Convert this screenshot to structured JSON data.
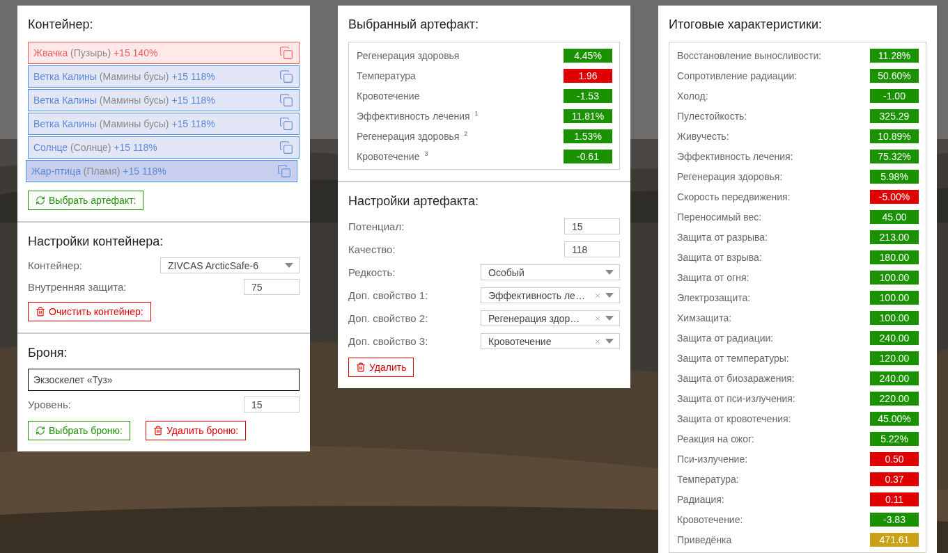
{
  "container": {
    "title": "Контейнер:",
    "artifacts": [
      {
        "name": "Жвачка",
        "type": "(Пузырь)",
        "bonus": "+15 140%",
        "kind": "negative",
        "selected": false
      },
      {
        "name": "Ветка Калины",
        "type": "(Мамины бусы)",
        "bonus": "+15 118%",
        "kind": "positive",
        "selected": false
      },
      {
        "name": "Ветка Калины",
        "type": "(Мамины бусы)",
        "bonus": "+15 118%",
        "kind": "positive",
        "selected": false
      },
      {
        "name": "Ветка Калины",
        "type": "(Мамины бусы)",
        "bonus": "+15 118%",
        "kind": "positive",
        "selected": false
      },
      {
        "name": "Солнце",
        "type": "(Солнце)",
        "bonus": "+15 118%",
        "kind": "positive",
        "selected": false
      },
      {
        "name": "Жар-птица",
        "type": "(Пламя)",
        "bonus": "+15 118%",
        "kind": "positive",
        "selected": true
      }
    ],
    "select_button": "Выбрать артефакт:"
  },
  "container_settings": {
    "title": "Настройки контейнера:",
    "fields": [
      {
        "label": "Контейнер:",
        "kind": "select",
        "value": "ZIVCAS ArcticSafe-6",
        "clearable": false
      },
      {
        "label": "Внутренняя защита:",
        "kind": "number",
        "value": "75"
      }
    ],
    "clear_button": "Очистить контейнер:"
  },
  "armor": {
    "title": "Броня:",
    "name": "Экзоскелет «Туз»",
    "fields": [
      {
        "label": "Уровень:",
        "kind": "number",
        "value": "15"
      }
    ],
    "select_button": "Выбрать броню:",
    "delete_button": "Удалить броню:"
  },
  "selected_artifact": {
    "title": "Выбранный артефакт:",
    "stats": [
      {
        "label": "Регенерация здоровья",
        "value": "4.45%",
        "color": "#1a9200"
      },
      {
        "label": "Температура",
        "value": "1.96",
        "color": "#e00000"
      },
      {
        "label": "Кровотечение",
        "value": "-1.53",
        "color": "#1a9200"
      },
      {
        "label": "Эффективность лечения $^{1}$",
        "value": "11.81%",
        "color": "#1a9200"
      },
      {
        "label": "Регенерация здоровья $^{2}$",
        "value": "1.53%",
        "color": "#1a9200"
      },
      {
        "label": "Кровотечение $^{3}$",
        "value": "-0.61",
        "color": "#1a9200"
      }
    ]
  },
  "artifact_settings": {
    "title": "Настройки артефакта:",
    "fields": [
      {
        "label": "Потенциал:",
        "kind": "number",
        "value": "15"
      },
      {
        "label": "Качество:",
        "kind": "number",
        "value": "118"
      },
      {
        "label": "Редкость:",
        "kind": "select",
        "value": "Особый",
        "clearable": false
      },
      {
        "label": "Доп. свойство 1:",
        "kind": "select",
        "value": "Эффективность ле…",
        "clearable": true
      },
      {
        "label": "Доп. свойство 2:",
        "kind": "select",
        "value": "Регенерация здор…",
        "clearable": true
      },
      {
        "label": "Доп. свойство 3:",
        "kind": "select",
        "value": "Кровотечение",
        "clearable": true
      }
    ],
    "delete_button": "Удалить"
  },
  "totals": {
    "title": "Итоговые характеристики:",
    "stats": [
      {
        "label": "Восстановление выносливости:",
        "value": "11.28%",
        "color": "#1a9200"
      },
      {
        "label": "Сопротивление радиации:",
        "value": "50.60%",
        "color": "#1a9200"
      },
      {
        "label": "Холод:",
        "value": "-1.00",
        "color": "#1a9200"
      },
      {
        "label": "Пулестойкость:",
        "value": "325.29",
        "color": "#1a9200"
      },
      {
        "label": "Живучесть:",
        "value": "10.89%",
        "color": "#1a9200"
      },
      {
        "label": "Эффективность лечения:",
        "value": "75.32%",
        "color": "#1a9200"
      },
      {
        "label": "Регенерация здоровья:",
        "value": "5.98%",
        "color": "#1a9200"
      },
      {
        "label": "Скорость передвижения:",
        "value": "-5.00%",
        "color": "#e00000"
      },
      {
        "label": "Переносимый вес:",
        "value": "45.00",
        "color": "#1a9200"
      },
      {
        "label": "Защита от разрыва:",
        "value": "213.00",
        "color": "#1a9200"
      },
      {
        "label": "Защита от взрыва:",
        "value": "180.00",
        "color": "#1a9200"
      },
      {
        "label": "Защита от огня:",
        "value": "100.00",
        "color": "#1a9200"
      },
      {
        "label": "Электрозащита:",
        "value": "100.00",
        "color": "#1a9200"
      },
      {
        "label": "Химзащита:",
        "value": "100.00",
        "color": "#1a9200"
      },
      {
        "label": "Защита от радиации:",
        "value": "240.00",
        "color": "#1a9200"
      },
      {
        "label": "Защита от температуры:",
        "value": "120.00",
        "color": "#1a9200"
      },
      {
        "label": "Защита от биозаражения:",
        "value": "240.00",
        "color": "#1a9200"
      },
      {
        "label": "Защита от пси-излучения:",
        "value": "220.00",
        "color": "#1a9200"
      },
      {
        "label": "Защита от кровотечения:",
        "value": "45.00%",
        "color": "#1a9200"
      },
      {
        "label": "Реакция на ожог:",
        "value": "5.22%",
        "color": "#1a9200"
      },
      {
        "label": "Пси-излучение:",
        "value": "0.50",
        "color": "#e00000"
      },
      {
        "label": "Температура:",
        "value": "0.37",
        "color": "#e00000"
      },
      {
        "label": "Радиация:",
        "value": "0.11",
        "color": "#e00000"
      },
      {
        "label": "Кровотечение:",
        "value": "-3.83",
        "color": "#1a9200"
      },
      {
        "label": "Приведёнка",
        "value": "471.61",
        "color": "#c9a016"
      }
    ]
  }
}
